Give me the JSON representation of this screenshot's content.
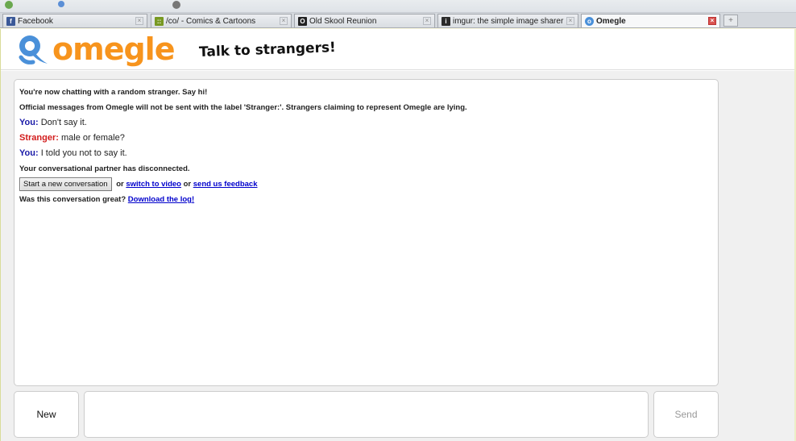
{
  "browser": {
    "tabs": [
      {
        "label": "Facebook",
        "icon": "facebook-icon",
        "color": "#3b5998",
        "glyph": "f"
      },
      {
        "label": "/co/ - Comics & Cartoons",
        "icon": "4chan-icon",
        "color": "#789922",
        "glyph": "::"
      },
      {
        "label": "Old Skool Reunion",
        "icon": "oldskool-icon",
        "color": "#222222",
        "glyph": "O"
      },
      {
        "label": "imgur: the simple image sharer",
        "icon": "imgur-icon",
        "color": "#2b2b2b",
        "glyph": "i"
      },
      {
        "label": "Omegle",
        "icon": "omegle-icon",
        "color": "#4a90d9",
        "glyph": "o",
        "active": true
      }
    ],
    "new_tab": "+"
  },
  "header": {
    "logo_text": "omegle",
    "tagline": "Talk to strangers!"
  },
  "chat": {
    "intro": "You're now chatting with a random stranger. Say hi!",
    "notice": "Official messages from Omegle will not be sent with the label 'Stranger:'. Strangers claiming to represent Omegle are lying.",
    "messages": [
      {
        "speaker": "You:",
        "text": "Don't say it."
      },
      {
        "speaker": "Stranger:",
        "text": "male or female?"
      },
      {
        "speaker": "You:",
        "text": "I told you not to say it."
      }
    ],
    "disconnected": "Your conversational partner has disconnected.",
    "new_conversation_button": "Start a new conversation",
    "or_1": "or",
    "switch_video": "switch to video",
    "or_2": "or",
    "feedback": "send us feedback",
    "great_question": "Was this conversation great?",
    "download_log": "Download the log!"
  },
  "controls": {
    "new_label": "New",
    "send_label": "Send",
    "input_value": ""
  },
  "colors": {
    "logo_orange": "#f7941d",
    "logo_blue": "#4a90d9",
    "you": "#1a1aa8",
    "stranger": "#d21c1c"
  }
}
